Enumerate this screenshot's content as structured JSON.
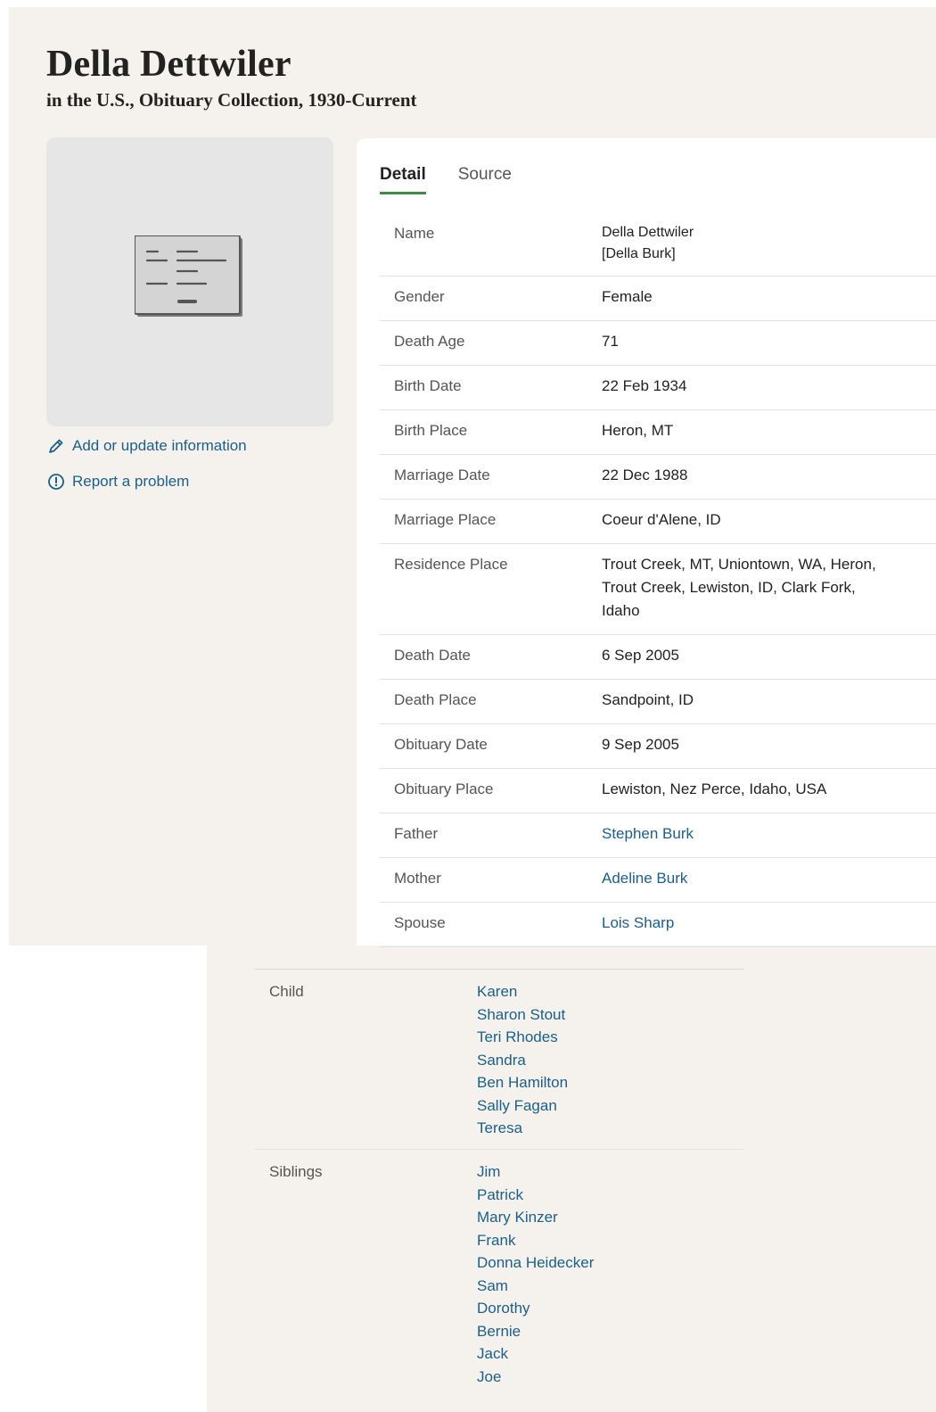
{
  "header": {
    "title": "Della Dettwiler",
    "subtitle": "in the U.S., Obituary Collection, 1930-Current"
  },
  "sidebar": {
    "add_update": "Add or update information",
    "report": "Report a problem"
  },
  "tabs": [
    {
      "label": "Detail",
      "active": true
    },
    {
      "label": "Source",
      "active": false
    }
  ],
  "details": {
    "name": {
      "label": "Name",
      "line1": "Della Dettwiler",
      "line2": "[Della Burk]"
    },
    "gender": {
      "label": "Gender",
      "value": "Female"
    },
    "death_age": {
      "label": "Death Age",
      "value": "71"
    },
    "birth_date": {
      "label": "Birth Date",
      "value": "22 Feb 1934"
    },
    "birth_place": {
      "label": "Birth Place",
      "value": "Heron, MT"
    },
    "marriage_date": {
      "label": "Marriage Date",
      "value": "22 Dec 1988"
    },
    "marriage_place": {
      "label": "Marriage Place",
      "value": "Coeur d'Alene, ID"
    },
    "residence_place": {
      "label": "Residence Place",
      "line1": "Trout Creek, MT, Uniontown, WA, Heron,",
      "line2": "Trout Creek, Lewiston, ID, Clark Fork,",
      "line3": "Idaho"
    },
    "death_date": {
      "label": "Death Date",
      "value": "6 Sep 2005"
    },
    "death_place": {
      "label": "Death Place",
      "value": "Sandpoint, ID"
    },
    "obituary_date": {
      "label": "Obituary Date",
      "value": "9 Sep 2005"
    },
    "obituary_place": {
      "label": "Obituary Place",
      "value": "Lewiston, Nez Perce, Idaho, USA"
    },
    "father": {
      "label": "Father",
      "value": "Stephen Burk"
    },
    "mother": {
      "label": "Mother",
      "value": "Adeline Burk"
    },
    "spouse": {
      "label": "Spouse",
      "value": "Lois Sharp"
    }
  },
  "children": {
    "label": "Child",
    "names": [
      "Karen",
      "Sharon Stout",
      "Teri Rhodes",
      "Sandra",
      "Ben Hamilton",
      "Sally Fagan",
      "Teresa"
    ]
  },
  "siblings": {
    "label": "Siblings",
    "names": [
      "Jim",
      "Patrick",
      "Mary Kinzer",
      "Frank",
      "Donna Heidecker",
      "Sam",
      "Dorothy",
      "Bernie",
      "Jack",
      "Joe"
    ]
  },
  "colors": {
    "background": "#f5f2ee",
    "link": "#1b5f8b",
    "tab_accent": "#3f8c47"
  }
}
